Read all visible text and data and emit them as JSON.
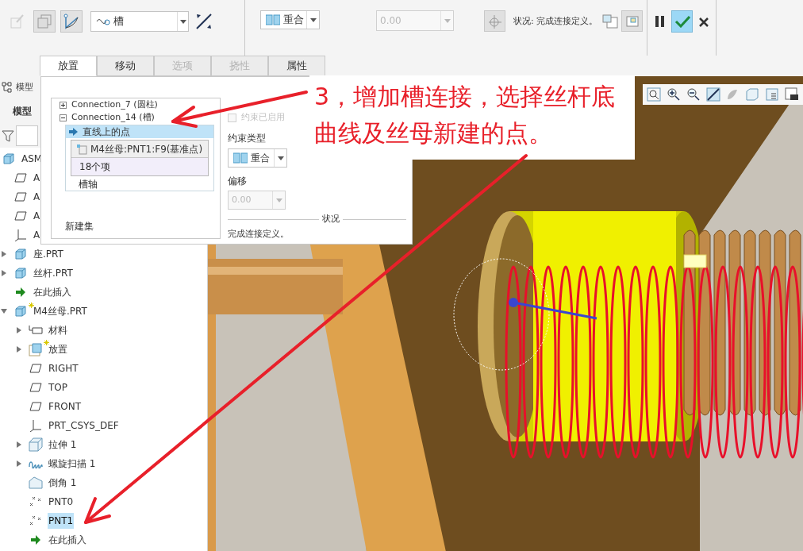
{
  "ribbon": {
    "tool_buttons": [
      {
        "kind": "edit",
        "disabled": true,
        "selected": false
      },
      {
        "kind": "copy",
        "disabled": false,
        "selected": true
      },
      {
        "kind": "curve",
        "disabled": false,
        "selected": true
      }
    ],
    "connection_type": {
      "value": "槽"
    },
    "constraint_type": {
      "value": "重合"
    },
    "offset_field": {
      "value": "0.00",
      "disabled": true
    },
    "status": "状况: 完成连接定义。"
  },
  "tabs": [
    {
      "label": "放置",
      "selected": true,
      "disabled": false
    },
    {
      "label": "移动",
      "selected": false,
      "disabled": false
    },
    {
      "label": "选项",
      "selected": false,
      "disabled": true
    },
    {
      "label": "挠性",
      "selected": false,
      "disabled": true
    },
    {
      "label": "属性",
      "selected": false,
      "disabled": false
    }
  ],
  "model_tree": {
    "header": "模型",
    "subheader": "模型",
    "items": [
      {
        "label": "ASM",
        "kind": "assembly",
        "selected": false,
        "modified": false,
        "children": [
          {
            "label": "A",
            "kind": "plane",
            "selected": false,
            "modified": false
          },
          {
            "label": "A",
            "kind": "plane",
            "selected": false,
            "modified": false
          },
          {
            "label": "A",
            "kind": "plane",
            "selected": false,
            "modified": false
          },
          {
            "label": "A",
            "kind": "csys",
            "selected": false,
            "modified": false
          },
          {
            "label": "座.PRT",
            "kind": "part",
            "expanded": false,
            "selected": false,
            "modified": false
          },
          {
            "label": "丝杆.PRT",
            "kind": "part",
            "expanded": false,
            "selected": false,
            "modified": false
          },
          {
            "label": "在此插入",
            "kind": "insert",
            "selected": false,
            "modified": false
          },
          {
            "label": "M4丝母.PRT",
            "kind": "part",
            "expanded": true,
            "selected": false,
            "modified": true,
            "children": [
              {
                "label": "材料",
                "kind": "material",
                "expanded": false,
                "selected": false,
                "modified": false
              },
              {
                "label": "放置",
                "kind": "placement",
                "expanded": false,
                "selected": false,
                "modified": true
              },
              {
                "label": "RIGHT",
                "kind": "plane",
                "selected": false,
                "modified": false
              },
              {
                "label": "TOP",
                "kind": "plane",
                "selected": false,
                "modified": false
              },
              {
                "label": "FRONT",
                "kind": "plane",
                "selected": false,
                "modified": false
              },
              {
                "label": "PRT_CSYS_DEF",
                "kind": "csys",
                "selected": false,
                "modified": false
              },
              {
                "label": "拉伸 1",
                "kind": "extrude",
                "expanded": false,
                "selected": false,
                "modified": false
              },
              {
                "label": "螺旋扫描 1",
                "kind": "helical",
                "expanded": false,
                "selected": false,
                "modified": false
              },
              {
                "label": "倒角 1",
                "kind": "chamfer",
                "selected": false,
                "modified": false
              },
              {
                "label": "PNT0",
                "kind": "point",
                "selected": false,
                "modified": false
              },
              {
                "label": "PNT1",
                "kind": "point",
                "selected": true,
                "modified": false
              },
              {
                "label": "在此插入",
                "kind": "insert",
                "selected": false,
                "modified": false
              }
            ]
          }
        ]
      }
    ]
  },
  "placement_panel": {
    "connections": [
      {
        "label": "Connection_7 (圆柱)",
        "expanded": false
      },
      {
        "label": "Connection_14 (槽)",
        "expanded": true,
        "constraints": [
          {
            "label": "直线上的点",
            "selected": true,
            "references": [
              "M4丝母:PNT1:F9(基准点)",
              "18个项"
            ]
          },
          {
            "label": "槽轴",
            "selected": false
          }
        ]
      }
    ],
    "new_set": "新建集",
    "constraint_enabled": {
      "label": "约束已启用",
      "checked": false,
      "disabled": true
    },
    "constraint_type_label": "约束类型",
    "constraint_type": "重合",
    "offset_label": "偏移",
    "offset": {
      "value": "0.00",
      "disabled": true
    },
    "status_heading": "状况",
    "status_text": "完成连接定义。"
  },
  "annotation": {
    "text": "3，增加槽连接，选择丝杆底曲线及丝母新建的点。"
  }
}
